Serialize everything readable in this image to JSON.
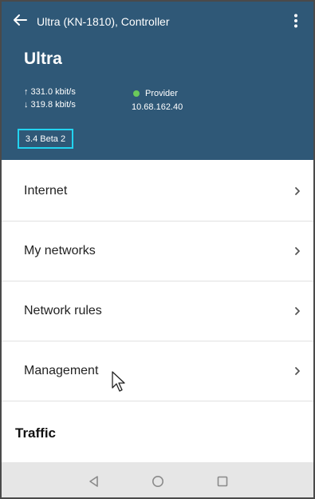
{
  "header": {
    "title": "Ultra (KN-1810), Controller",
    "device_name": "Ultra",
    "upload": "↑ 331.0 kbit/s",
    "download": "↓ 319.8 kbit/s",
    "provider_label": "Provider",
    "ip": "10.68.162.40",
    "version": "3.4 Beta 2",
    "bg_color": "#2f5877"
  },
  "menu": {
    "items": [
      {
        "label": "Internet"
      },
      {
        "label": "My networks"
      },
      {
        "label": "Network rules"
      },
      {
        "label": "Management"
      }
    ]
  },
  "section": {
    "traffic_title": "Traffic"
  },
  "icons": {
    "back": "arrow-left",
    "more": "vertical-ellipsis",
    "chevron": "chevron-right",
    "nav_back": "triangle-left",
    "nav_home": "circle",
    "nav_recents": "square"
  }
}
